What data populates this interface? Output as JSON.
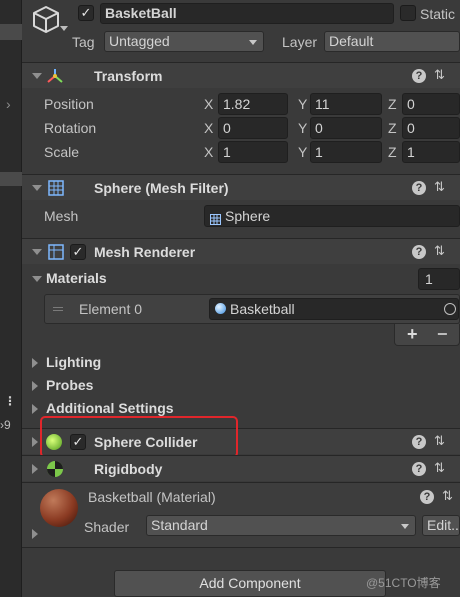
{
  "object": {
    "name": "BasketBall",
    "static_label": "Static",
    "tag_label": "Tag",
    "tag_value": "Untagged",
    "layer_label": "Layer",
    "layer_value": "Default"
  },
  "transform": {
    "title": "Transform",
    "rows": [
      {
        "label": "Position",
        "x": "1.82",
        "y": "11",
        "z": "0"
      },
      {
        "label": "Rotation",
        "x": "0",
        "y": "0",
        "z": "0"
      },
      {
        "label": "Scale",
        "x": "1",
        "y": "1",
        "z": "1"
      }
    ],
    "axes": {
      "x": "X",
      "y": "Y",
      "z": "Z"
    }
  },
  "mesh_filter": {
    "title": "Sphere (Mesh Filter)",
    "mesh_label": "Mesh",
    "mesh_value": "Sphere"
  },
  "mesh_renderer": {
    "title": "Mesh Renderer",
    "materials_label": "Materials",
    "materials_count": "1",
    "element_label": "Element 0",
    "element_value": "Basketball",
    "add_symbol": "+",
    "remove_symbol": "−"
  },
  "sections": {
    "lighting": "Lighting",
    "probes": "Probes",
    "additional": "Additional Settings"
  },
  "sphere_collider": {
    "title": "Sphere Collider",
    "highlight_color": "#e0262b"
  },
  "rigidbody": {
    "title": "Rigidbody"
  },
  "material": {
    "name": "Basketball (Material)",
    "shader_label": "Shader",
    "shader_value": "Standard",
    "edit_label": "Edit..."
  },
  "footer": {
    "add_component": "Add Component"
  },
  "left_strip": {
    "number": "9"
  },
  "watermark": "@51CTO博客"
}
